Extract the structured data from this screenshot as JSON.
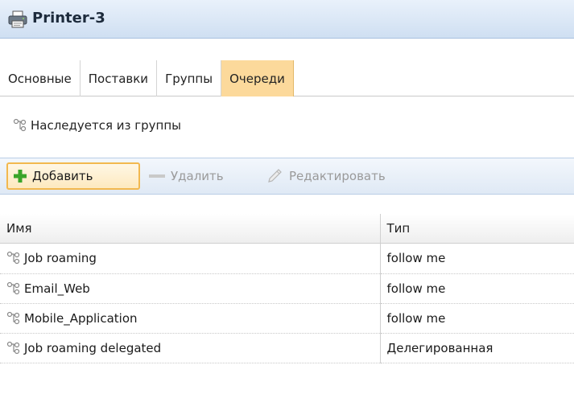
{
  "window": {
    "title": "Printer-3",
    "icon": "printer-icon"
  },
  "tabs": [
    {
      "label": "Основные",
      "active": false
    },
    {
      "label": "Поставки",
      "active": false
    },
    {
      "label": "Группы",
      "active": false
    },
    {
      "label": "Очереди",
      "active": true
    }
  ],
  "inherit": {
    "label": "Наследуется из группы",
    "icon": "queue-node-icon"
  },
  "toolbar": {
    "add_label": "Добавить",
    "remove_label": "Удалить",
    "edit_label": "Редактировать"
  },
  "table": {
    "columns": [
      "Имя",
      "Тип"
    ],
    "rows": [
      {
        "name": "Job roaming",
        "type": "follow me"
      },
      {
        "name": "Email_Web",
        "type": "follow me"
      },
      {
        "name": "Mobile_Application",
        "type": "follow me"
      },
      {
        "name": "Job roaming delegated",
        "type": "Делегированная"
      }
    ]
  },
  "colors": {
    "active_tab": "#fcd99b",
    "add_button_border": "#f2b84f",
    "add_icon": "#3aa52a",
    "toolbar_bg": "#dfe9f5"
  }
}
